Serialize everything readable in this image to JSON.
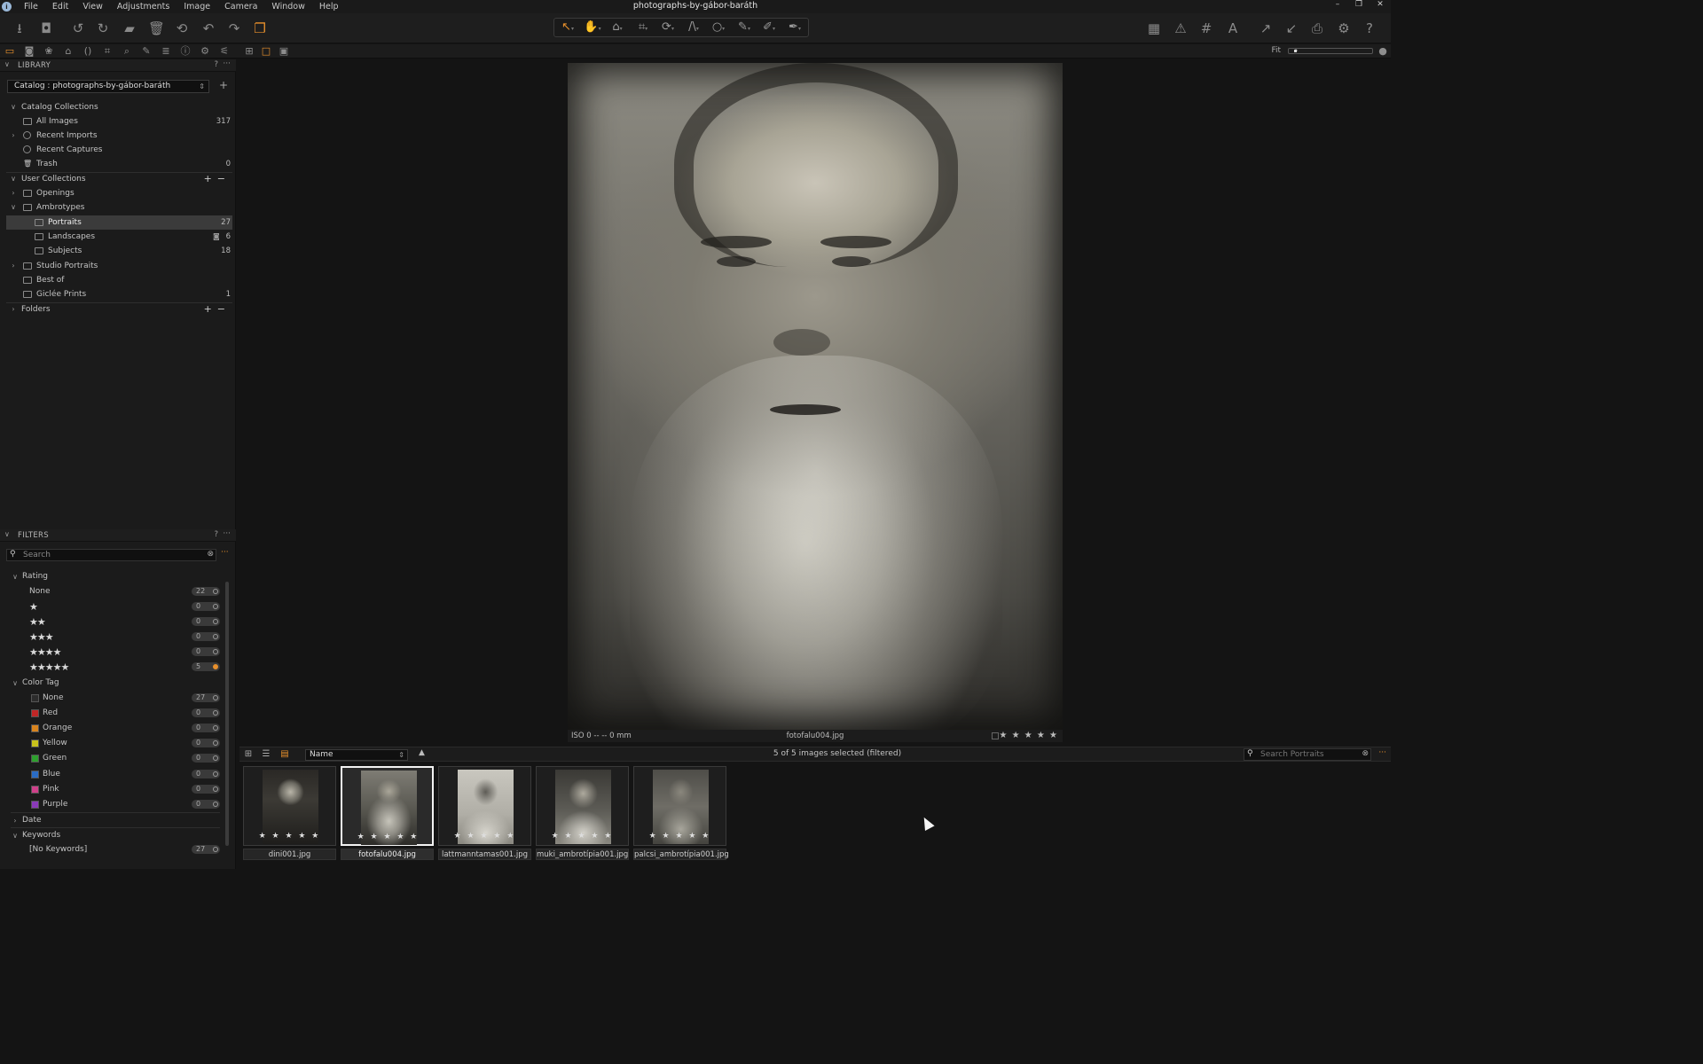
{
  "window": {
    "title": "photographs-by-gábor-baráth",
    "controls": [
      "–",
      "❐",
      "✕"
    ]
  },
  "menu": [
    "File",
    "Edit",
    "View",
    "Adjustments",
    "Image",
    "Camera",
    "Window",
    "Help"
  ],
  "library": {
    "header": "LIBRARY",
    "help": "?",
    "catalog_label": "Catalog : photographs-by-gábor-baráth",
    "catalog_collections": {
      "label": "Catalog Collections",
      "items": [
        {
          "label": "All Images",
          "count": "317"
        },
        {
          "label": "Recent Imports",
          "count": ""
        },
        {
          "label": "Recent Captures",
          "count": ""
        },
        {
          "label": "Trash",
          "count": "0"
        }
      ]
    },
    "user_collections": {
      "label": "User Collections",
      "items": [
        {
          "label": "Openings",
          "count": ""
        },
        {
          "label": "Ambrotypes",
          "count": ""
        },
        {
          "label": "Portraits",
          "count": "27",
          "selected": true
        },
        {
          "label": "Landscapes",
          "count": "6"
        },
        {
          "label": "Subjects",
          "count": "18"
        },
        {
          "label": "Studio Portraits",
          "count": ""
        },
        {
          "label": "Best of",
          "count": ""
        },
        {
          "label": "Giclée Prints",
          "count": "1"
        }
      ]
    },
    "folders": {
      "label": "Folders"
    }
  },
  "filters": {
    "header": "FILTERS",
    "help": "?",
    "search_placeholder": "Search",
    "rating": {
      "label": "Rating",
      "rows": [
        {
          "label": "None",
          "stars": "",
          "count": "22"
        },
        {
          "label": "",
          "stars": "★",
          "count": "0"
        },
        {
          "label": "",
          "stars": "★★",
          "count": "0"
        },
        {
          "label": "",
          "stars": "★★★",
          "count": "0"
        },
        {
          "label": "",
          "stars": "★★★★",
          "count": "0"
        },
        {
          "label": "",
          "stars": "★★★★★",
          "count": "5",
          "active": true
        }
      ]
    },
    "color_tag": {
      "label": "Color Tag",
      "rows": [
        {
          "label": "None",
          "color": "#2c2c2c",
          "count": "27"
        },
        {
          "label": "Red",
          "color": "#c02626",
          "count": "0"
        },
        {
          "label": "Orange",
          "color": "#d9841e",
          "count": "0"
        },
        {
          "label": "Yellow",
          "color": "#c8c21c",
          "count": "0"
        },
        {
          "label": "Green",
          "color": "#2ea02e",
          "count": "0"
        },
        {
          "label": "Blue",
          "color": "#2a6cc4",
          "count": "0"
        },
        {
          "label": "Pink",
          "color": "#d0408a",
          "count": "0"
        },
        {
          "label": "Purple",
          "color": "#8a3ab8",
          "count": "0"
        }
      ]
    },
    "date": {
      "label": "Date"
    },
    "keywords": {
      "label": "Keywords",
      "rows": [
        {
          "label": "[No Keywords]",
          "count": "27"
        }
      ]
    }
  },
  "viewer": {
    "zoom_label": "Fit",
    "info_iso": "ISO 0 -- -- 0 mm",
    "info_filename": "fotofalu004.jpg",
    "info_rating": "★ ★ ★ ★ ★"
  },
  "browser": {
    "sort_label": "Name",
    "sort_dir": "▲",
    "selection_status": "5 of 5 images selected (filtered)",
    "search_placeholder": "Search Portraits",
    "thumbnails": [
      {
        "name": "dini001.jpg",
        "stars": "★ ★ ★ ★ ★",
        "selected": false
      },
      {
        "name": "fotofalu004.jpg",
        "stars": "★ ★ ★ ★ ★",
        "selected": true
      },
      {
        "name": "lattmanntamas001.jpg",
        "stars": "★ ★ ★ ★ ★",
        "selected": false
      },
      {
        "name": "muki_ambrotípia001.jpg",
        "stars": "★ ★ ★ ★ ★",
        "selected": false
      },
      {
        "name": "palcsi_ambrotípia001.jpg",
        "stars": "★ ★ ★ ★ ★",
        "selected": false
      }
    ]
  },
  "accent_color": "#e8902c"
}
